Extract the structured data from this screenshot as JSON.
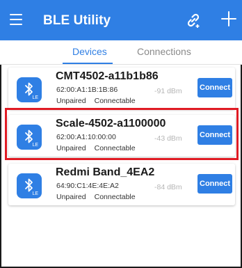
{
  "app": {
    "title": "BLE Utility"
  },
  "tabs": [
    {
      "label": "Devices",
      "active": true
    },
    {
      "label": "Connections",
      "active": false
    }
  ],
  "devices": [
    {
      "name": "CMT4502-a11b1b86",
      "mac": "62:00:A1:1B:1B:86",
      "bond_state": "Unpaired",
      "connectable": "Connectable",
      "rssi": "-91 dBm",
      "button": "Connect",
      "badge": "LE"
    },
    {
      "name": "Scale-4502-a1100000",
      "mac": "62:00:A1:10:00:00",
      "bond_state": "Unpaired",
      "connectable": "Connectable",
      "rssi": "-43 dBm",
      "button": "Connect",
      "badge": "LE",
      "highlighted": true
    },
    {
      "name": "Redmi Band_4EA2",
      "mac": "64:90:C1:4E:4E:A2",
      "bond_state": "Unpaired",
      "connectable": "Connectable",
      "rssi": "-84 dBm",
      "button": "Connect",
      "badge": "LE"
    }
  ],
  "icons": {
    "menu": "hamburger-menu-icon",
    "link": "link-icon",
    "add": "plus-icon",
    "device": "bluetooth-le-icon"
  },
  "colors": {
    "accent": "#2f7fe4",
    "highlight": "#e01b24",
    "rssi": "#b5b5b5"
  }
}
